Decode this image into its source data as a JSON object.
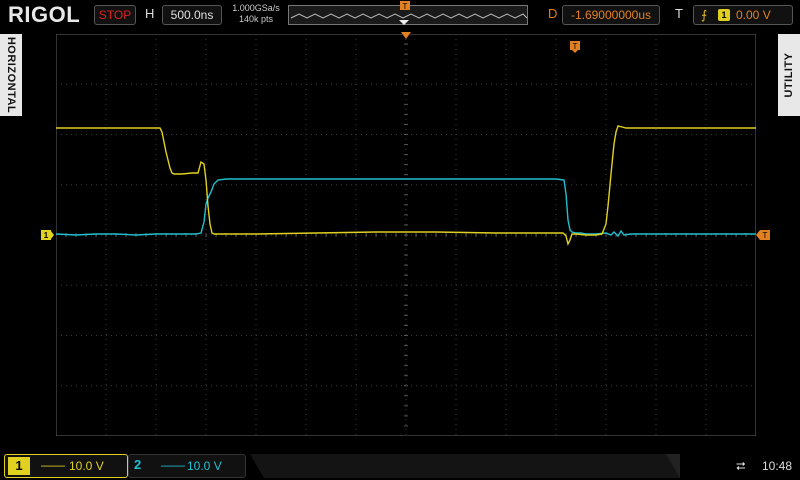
{
  "header": {
    "brand": "RIGOL",
    "run_status": "STOP",
    "horizontal_label": "H",
    "timebase": "500.0ns",
    "sample_rate": "1.000GSa/s",
    "memory_depth": "140k pts",
    "delay_label": "D",
    "delay": "-1.69000000us",
    "trigger_label": "T",
    "trigger_source": "1",
    "trigger_level": "0.00 V"
  },
  "side_tabs": {
    "left": "HORIZONTAL",
    "right": "UTILITY"
  },
  "channels": [
    {
      "number": "1",
      "coupling": "——",
      "scale": "10.0 V",
      "color": "#e0d020"
    },
    {
      "number": "2",
      "coupling": "——",
      "scale": "10.0 V",
      "color": "#20c0d0"
    }
  ],
  "markers": {
    "ch1_ground": "1",
    "trigger_level": "T"
  },
  "status_bar": {
    "time": "10:48"
  },
  "colors": {
    "ch1": "#e0d020",
    "ch2": "#20c0d0",
    "trigger": "#e08020",
    "grid": "#3a3a3a",
    "stop": "#e02020"
  }
}
